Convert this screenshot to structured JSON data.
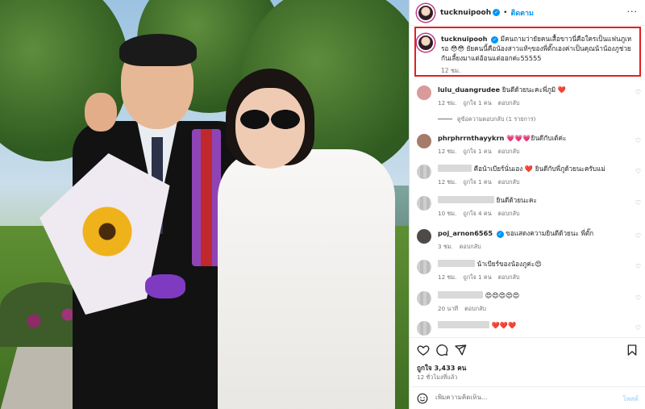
{
  "post": {
    "username": "tucknuipooh",
    "verified_mark": "✓",
    "separator": "•",
    "follow_label": "ติดตาม",
    "more_label": "···"
  },
  "caption": {
    "username": "tucknuipooh",
    "text": "มีคนถามว่ายัยคนเสื้อขาวนี่คือใครเป็นแฟนภูเหรอ 😳😳 ยัยคนนี้คือน้องสาวแท้ๆของพี่ตั๊กเองค่าเป็นคุณน้าน้องภูช่วยกันเลี้ยงมาแต่อ้อนแต่ออกค่ะ55555",
    "time": "12 ชม."
  },
  "comments": [
    {
      "user": "lulu_duangrudee",
      "text": "ยินดีด้วยนะคะพี่ภูมิ ❤️",
      "time": "12 ชม.",
      "likes": "ถูกใจ 1 คน",
      "reply": "ตอบกลับ",
      "heart": "♡",
      "avatar_color": "#d89a9a"
    },
    {
      "view_replies": "ดูข้อความตอบกลับ (1 รายการ)"
    },
    {
      "user": "phrphrrnthayykrn",
      "text": "💗💗💗ยินดีกับเด้ค่ะ",
      "time": "12 ชม.",
      "likes": "ถูกใจ 1 คน",
      "reply": "ตอบกลับ",
      "heart": "♡",
      "avatar_color": "#a57b69"
    },
    {
      "user": "",
      "text": "คือน้าเบียร์นั่นเอง ❤️ ยินดีกับพี่ภูด้วยนะครับแม่",
      "time": "12 ชม.",
      "likes": "ถูกใจ 1 คน",
      "reply": "ตอบกลับ",
      "heart": "♡",
      "blurred": true
    },
    {
      "user": "",
      "text": "ยินดีด้วยนะคะ",
      "time": "10 ชม.",
      "likes": "ถูกใจ 4 คน",
      "reply": "ตอบกลับ",
      "heart": "♡",
      "blurred": true
    },
    {
      "user": "poj_arnon6565",
      "text": "ขอแสดงความยินดีด้วยนะ พี่ตั๊ก",
      "time": "3 ชม.",
      "likes": "",
      "reply": "ตอบกลับ",
      "heart": "♡",
      "verified": true,
      "avatar_color": "#4d4a48"
    },
    {
      "user": "",
      "text": "น้าเบียร์ของน้องภูค่ะ😍",
      "time": "12 ชม.",
      "likes": "ถูกใจ 1 คน",
      "reply": "ตอบกลับ",
      "heart": "♡",
      "blurred": true
    },
    {
      "user": "",
      "text": "😍😍😍😍😍",
      "time": "20 นาที",
      "likes": "",
      "reply": "ตอบกลับ",
      "heart": "♡",
      "blurred": true
    },
    {
      "user": "",
      "text": "❤️❤️❤️",
      "time": "",
      "likes": "",
      "reply": "",
      "heart": "♡",
      "blurred": true
    }
  ],
  "actions": {
    "like_icon": "heart-icon",
    "comment_icon": "comment-icon",
    "share_icon": "share-icon",
    "save_icon": "bookmark-icon",
    "likes_text": "ถูกใจ 3,433 คน",
    "date_text": "12 ชั่วโมงที่แล้ว"
  },
  "add_comment": {
    "placeholder": "เพิ่มความคิดเห็น...",
    "post_label": "โพสต์"
  },
  "colors": {
    "accent": "#0095f6",
    "highlight_border": "#e02020",
    "muted": "#737373",
    "heart_red": "#ed4956"
  }
}
